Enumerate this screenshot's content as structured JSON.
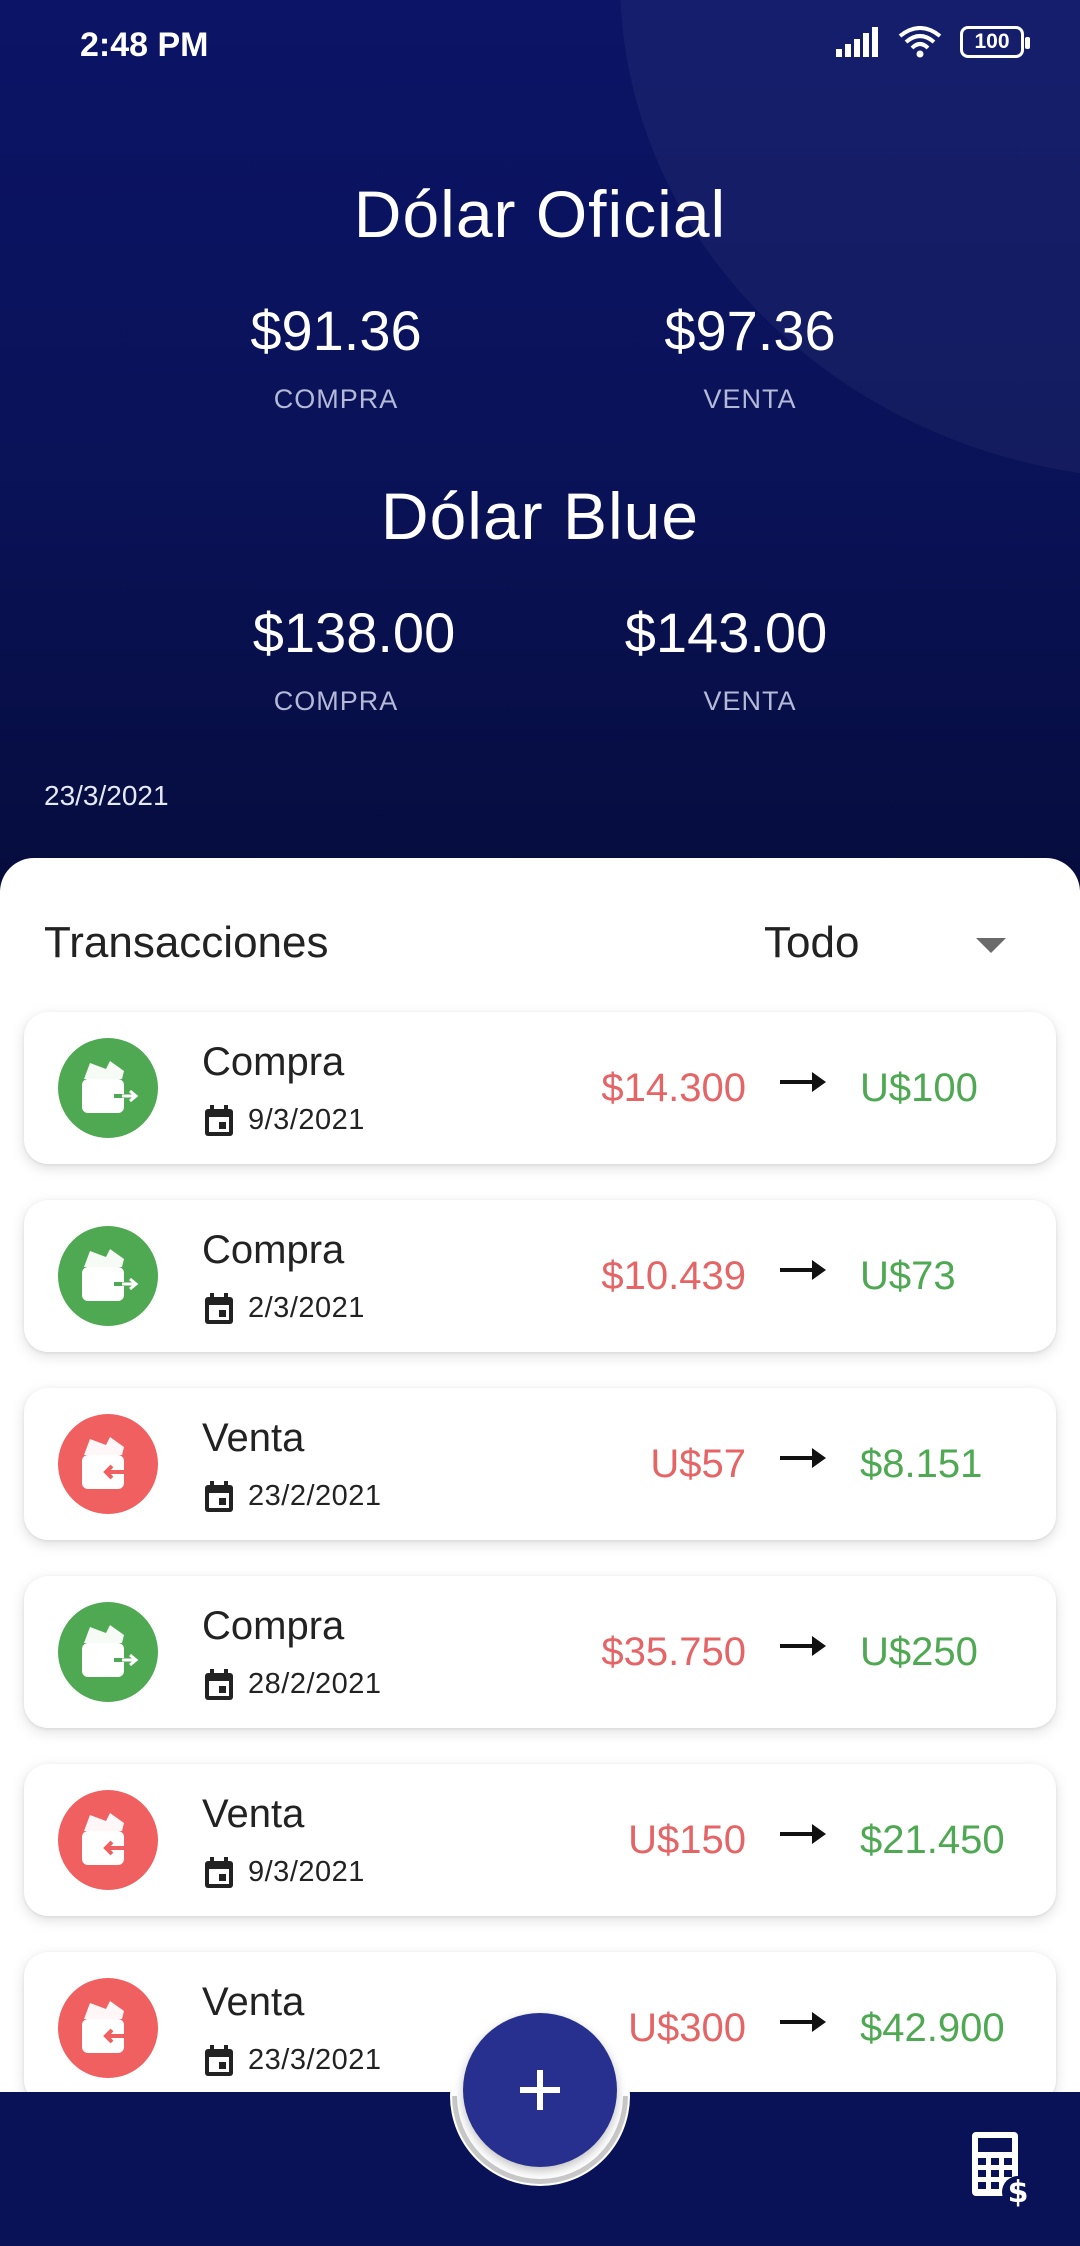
{
  "status_bar": {
    "time": "2:48 PM",
    "battery": "100"
  },
  "rates": [
    {
      "title": "Dólar Oficial",
      "buy_value": "$91.36",
      "buy_label": "COMPRA",
      "sell_value": "$97.36",
      "sell_label": "VENTA"
    },
    {
      "title": "Dólar Blue",
      "buy_value": "$138.00",
      "buy_label": "COMPRA",
      "sell_value": "$143.00",
      "sell_label": "VENTA"
    }
  ],
  "rates_date": "23/3/2021",
  "transactions": {
    "title": "Transacciones",
    "filter_value": "Todo",
    "items": [
      {
        "type": "Compra",
        "date": "9/3/2021",
        "from": "$14.300",
        "to": "U$100",
        "icon": "wallet-out-icon",
        "color": "#4fa852"
      },
      {
        "type": "Compra",
        "date": "2/3/2021",
        "from": "$10.439",
        "to": "U$73",
        "icon": "wallet-out-icon",
        "color": "#4fa852"
      },
      {
        "type": "Venta",
        "date": "23/2/2021",
        "from": "U$57",
        "to": "$8.151",
        "icon": "wallet-in-icon",
        "color": "#f06060"
      },
      {
        "type": "Compra",
        "date": "28/2/2021",
        "from": "$35.750",
        "to": "U$250",
        "icon": "wallet-out-icon",
        "color": "#4fa852"
      },
      {
        "type": "Venta",
        "date": "9/3/2021",
        "from": "U$150",
        "to": "$21.450",
        "icon": "wallet-in-icon",
        "color": "#f06060"
      },
      {
        "type": "Venta",
        "date": "23/3/2021",
        "from": "U$300",
        "to": "$42.900",
        "icon": "wallet-in-icon",
        "color": "#f06060"
      }
    ]
  },
  "colors": {
    "header": "#0a1257",
    "fab": "#28308f",
    "positive": "#4fa852",
    "negative": "#e56466"
  },
  "bottom_bar": {
    "add_icon": "plus-icon",
    "calculator_icon": "calculator-dollar-icon"
  }
}
